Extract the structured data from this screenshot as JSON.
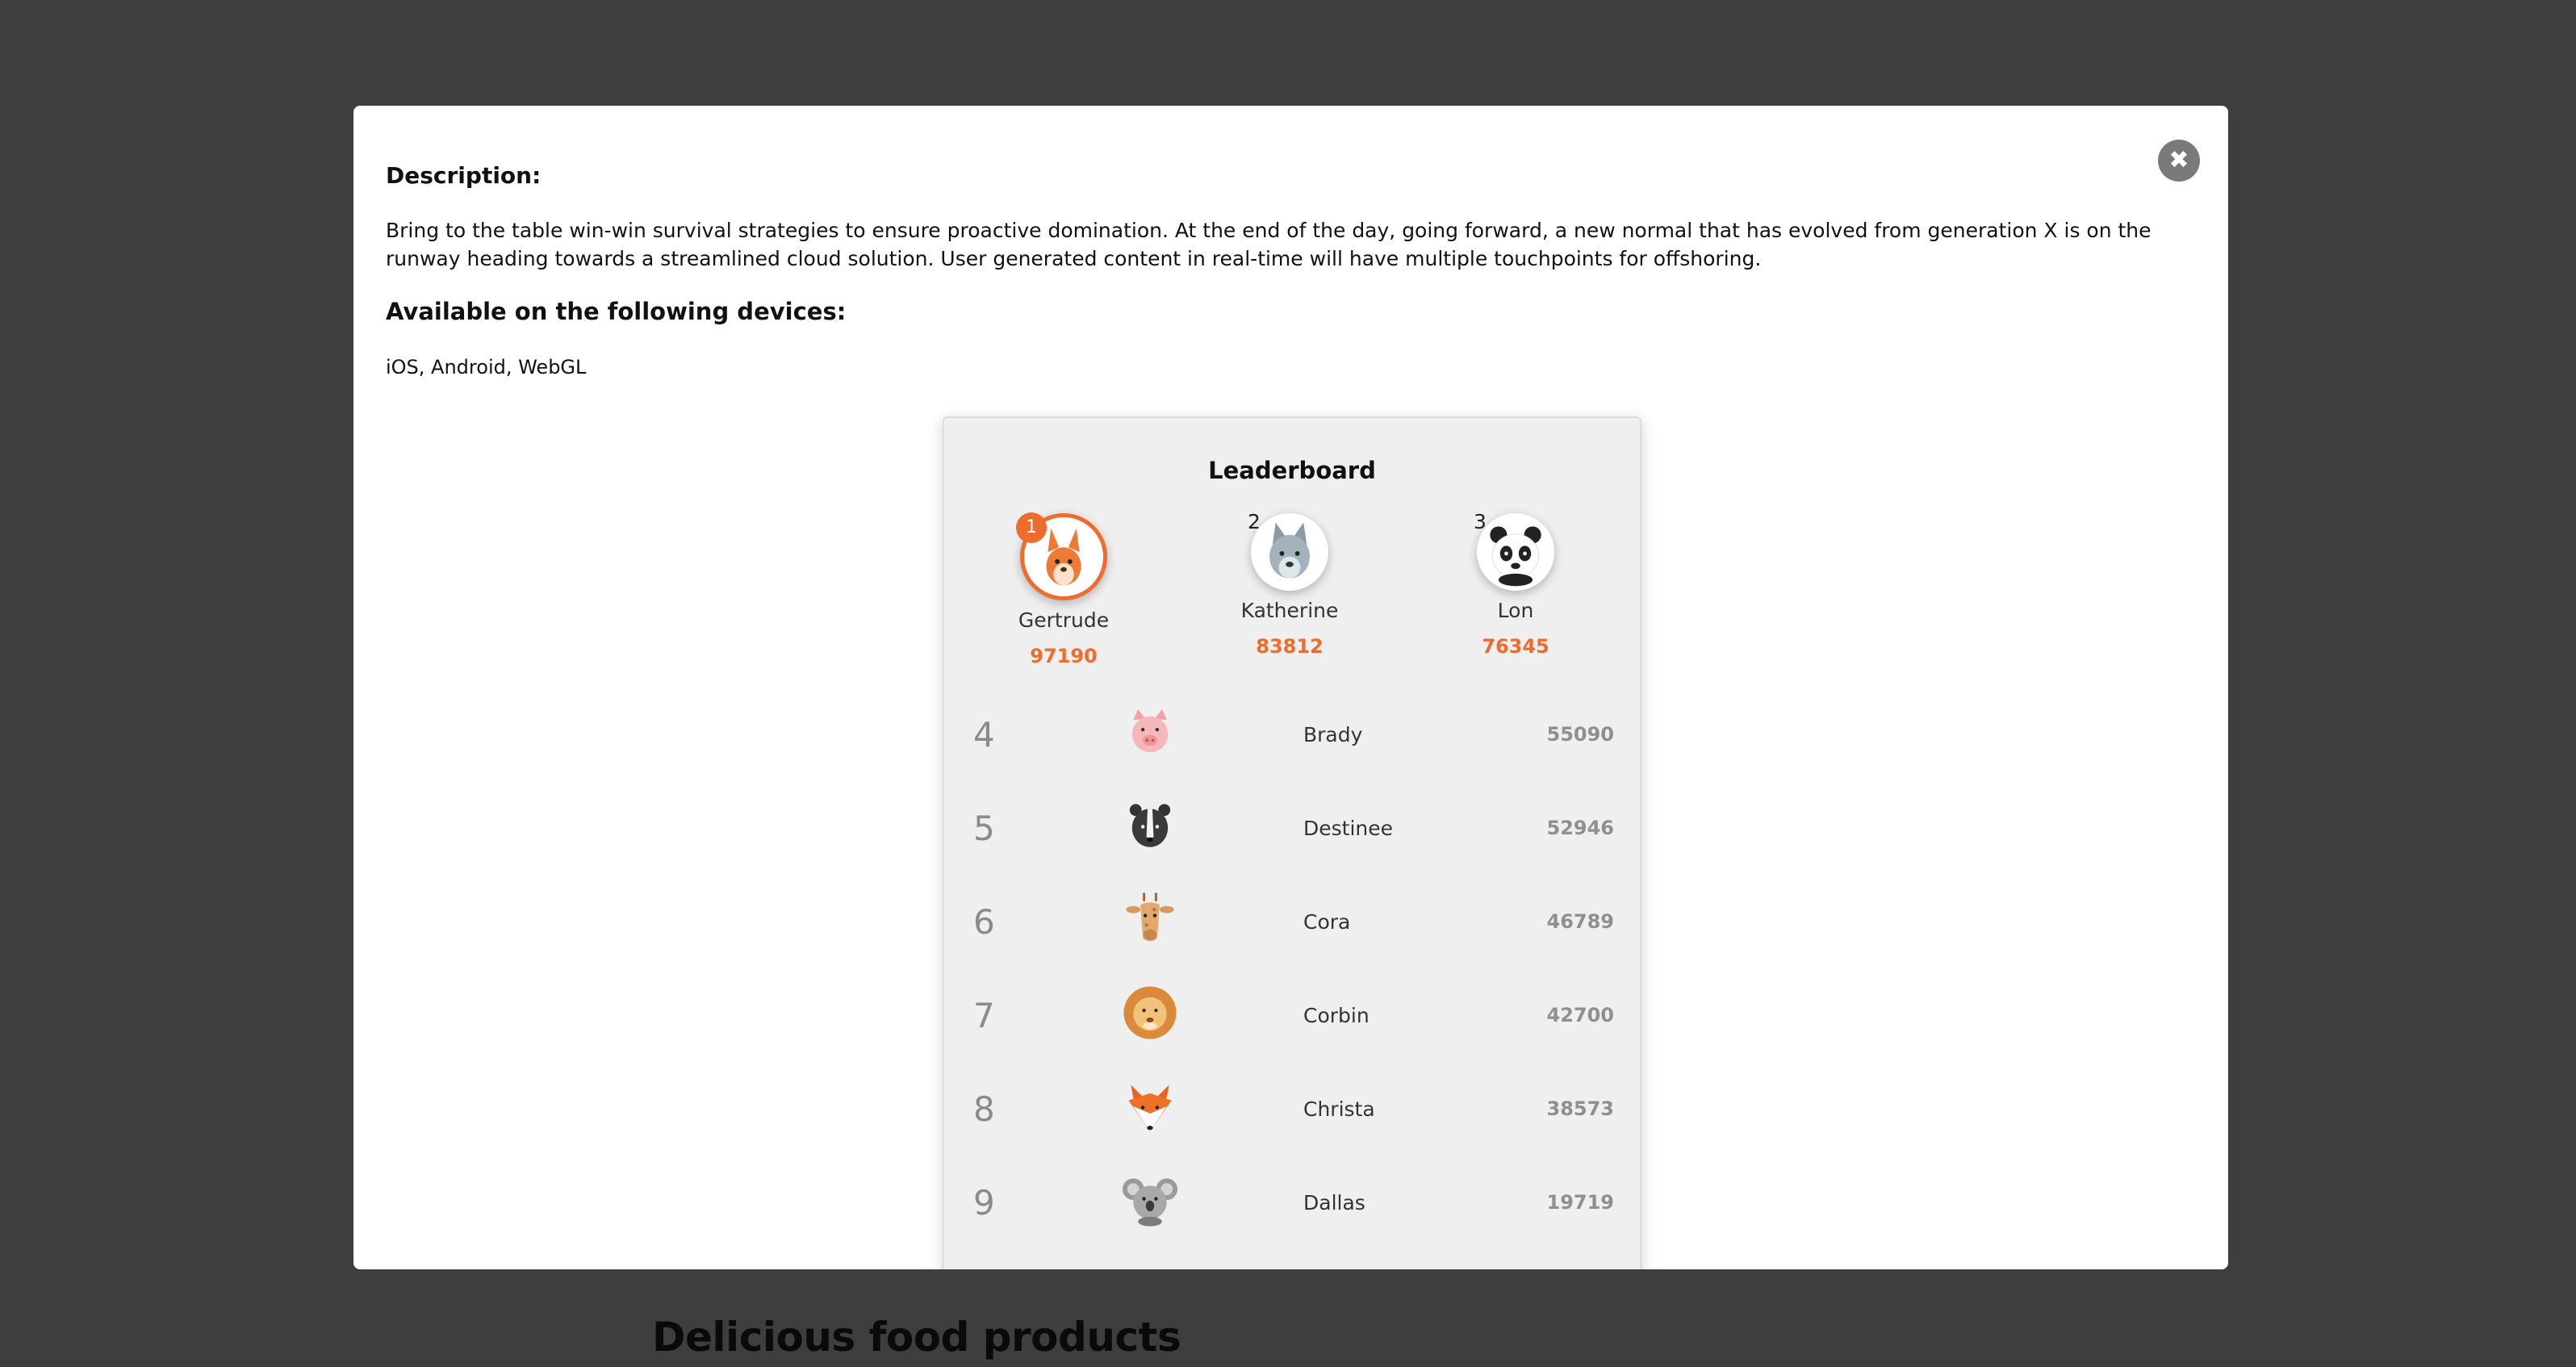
{
  "background": {
    "heading": "Delicious food products"
  },
  "modal": {
    "close_glyph": "✖",
    "description_title": "Description:",
    "description_text": "Bring to the table win-win survival strategies to ensure proactive domination. At the end of the day, going forward, a new normal that has evolved from generation X is on the runway heading towards a streamlined cloud solution. User generated content in real-time will have multiple touchpoints for offshoring.",
    "devices_title": "Available on the following devices:",
    "devices_text": "iOS, Android, WebGL"
  },
  "leaderboard": {
    "title": "Leaderboard",
    "accent_color": "#ef6c2f",
    "podium": [
      {
        "rank": "1",
        "name": "Gertrude",
        "score": "97190",
        "icon": "squirrel-icon"
      },
      {
        "rank": "2",
        "name": "Katherine",
        "score": "83812",
        "icon": "wolf-icon"
      },
      {
        "rank": "3",
        "name": "Lon",
        "score": "76345",
        "icon": "panda-icon"
      }
    ],
    "rows": [
      {
        "rank": "4",
        "name": "Brady",
        "score": "55090",
        "icon": "pig-icon"
      },
      {
        "rank": "5",
        "name": "Destinee",
        "score": "52946",
        "icon": "skunk-icon"
      },
      {
        "rank": "6",
        "name": "Cora",
        "score": "46789",
        "icon": "giraffe-icon"
      },
      {
        "rank": "7",
        "name": "Corbin",
        "score": "42700",
        "icon": "lion-icon"
      },
      {
        "rank": "8",
        "name": "Christa",
        "score": "38573",
        "icon": "fox-icon"
      },
      {
        "rank": "9",
        "name": "Dallas",
        "score": "19719",
        "icon": "koala-icon"
      }
    ]
  }
}
